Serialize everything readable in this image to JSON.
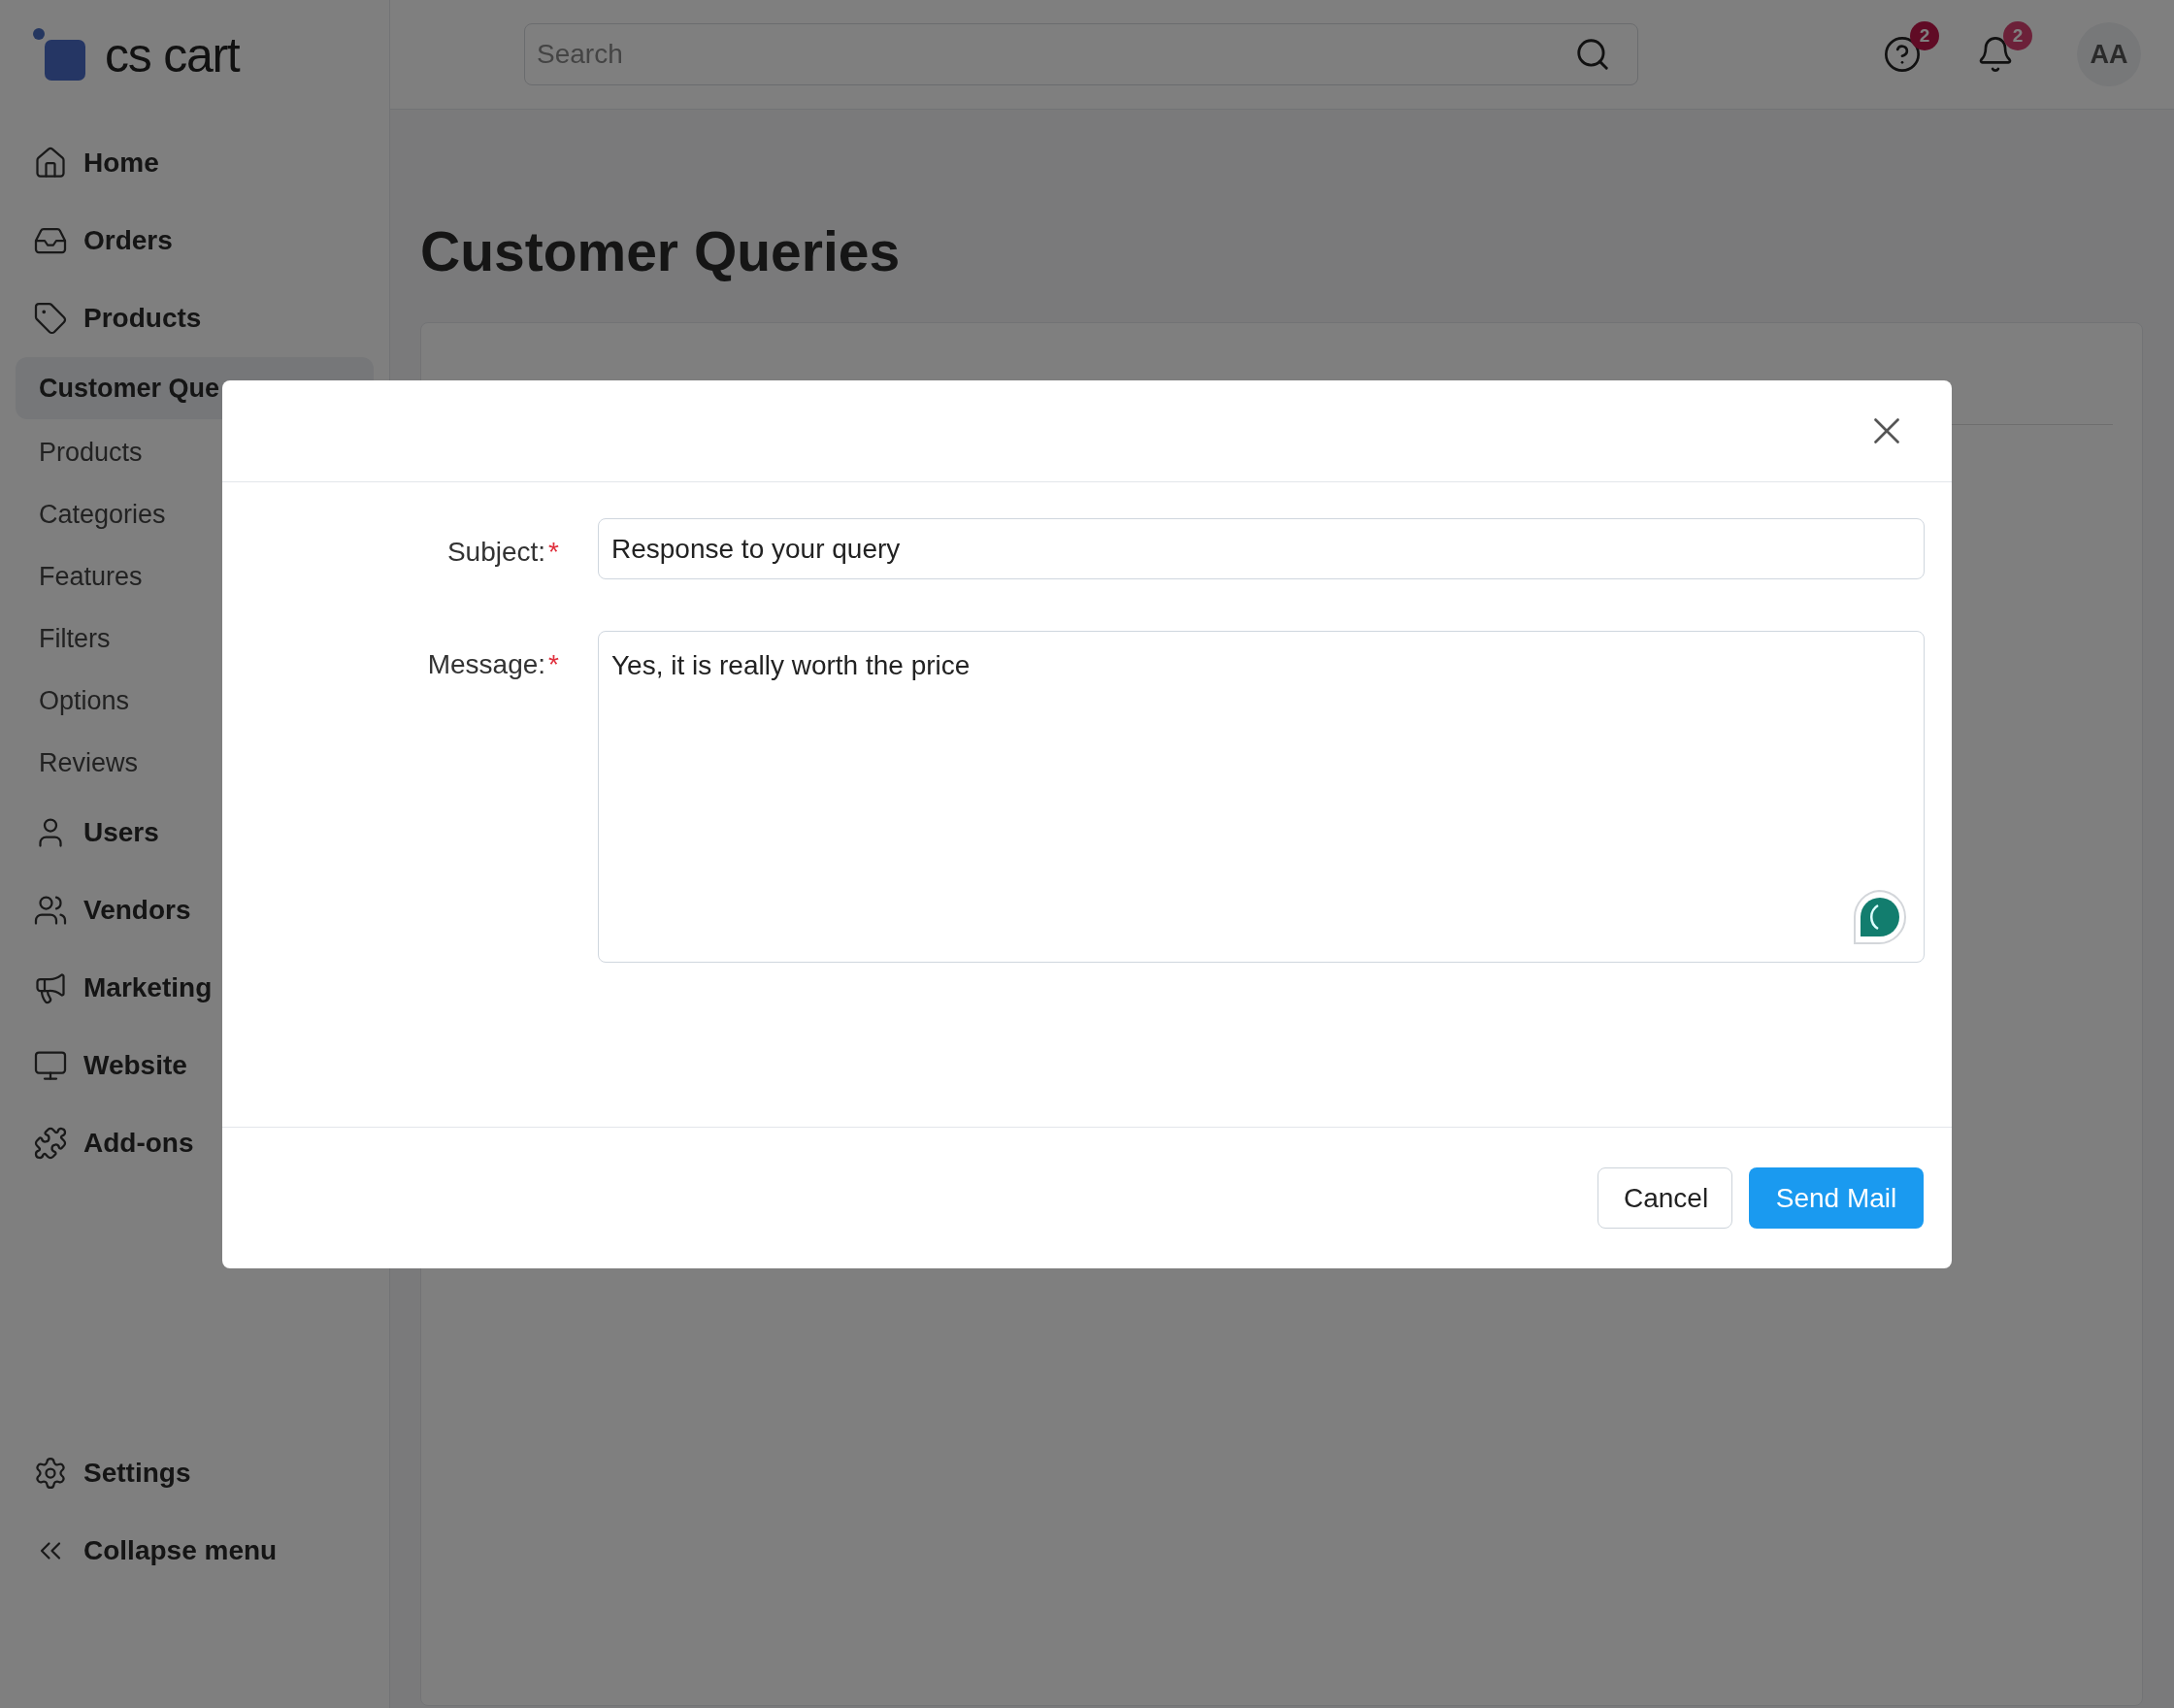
{
  "logo": {
    "text": "cs cart"
  },
  "sidebar": {
    "items": [
      {
        "label": "Home",
        "kind": "main",
        "selected": false
      },
      {
        "label": "Orders",
        "kind": "main",
        "selected": false
      },
      {
        "label": "Products",
        "kind": "main",
        "selected": false
      },
      {
        "label": "Customer Que",
        "kind": "sub",
        "selected": true
      },
      {
        "label": "Products",
        "kind": "sub",
        "selected": false
      },
      {
        "label": "Categories",
        "kind": "sub",
        "selected": false
      },
      {
        "label": "Features",
        "kind": "sub",
        "selected": false
      },
      {
        "label": "Filters",
        "kind": "sub",
        "selected": false
      },
      {
        "label": "Options",
        "kind": "sub",
        "selected": false
      },
      {
        "label": "Reviews",
        "kind": "sub",
        "selected": false
      },
      {
        "label": "Users",
        "kind": "main",
        "selected": false
      },
      {
        "label": "Vendors",
        "kind": "main",
        "selected": false
      },
      {
        "label": "Marketing",
        "kind": "main",
        "selected": false
      },
      {
        "label": "Website",
        "kind": "main",
        "selected": false
      },
      {
        "label": "Add-ons",
        "kind": "main",
        "selected": false
      }
    ],
    "bottom": [
      {
        "label": "Settings"
      },
      {
        "label": "Collapse menu"
      }
    ]
  },
  "header": {
    "search": {
      "placeholder": "Search"
    },
    "help_badge": "2",
    "notifications_badge": "2",
    "avatar": "AA"
  },
  "page": {
    "title": "Customer Queries"
  },
  "dialog": {
    "fields": [
      {
        "label": "Subject:",
        "required_mark": "*",
        "kind": "input",
        "value": "Response to your query"
      },
      {
        "label": "Message:",
        "required_mark": "*",
        "kind": "textarea",
        "value": "Yes, it is really worth the price"
      }
    ],
    "buttons": [
      {
        "label": "Cancel",
        "kind": "secondary"
      },
      {
        "label": "Send Mail",
        "kind": "primary"
      }
    ]
  }
}
